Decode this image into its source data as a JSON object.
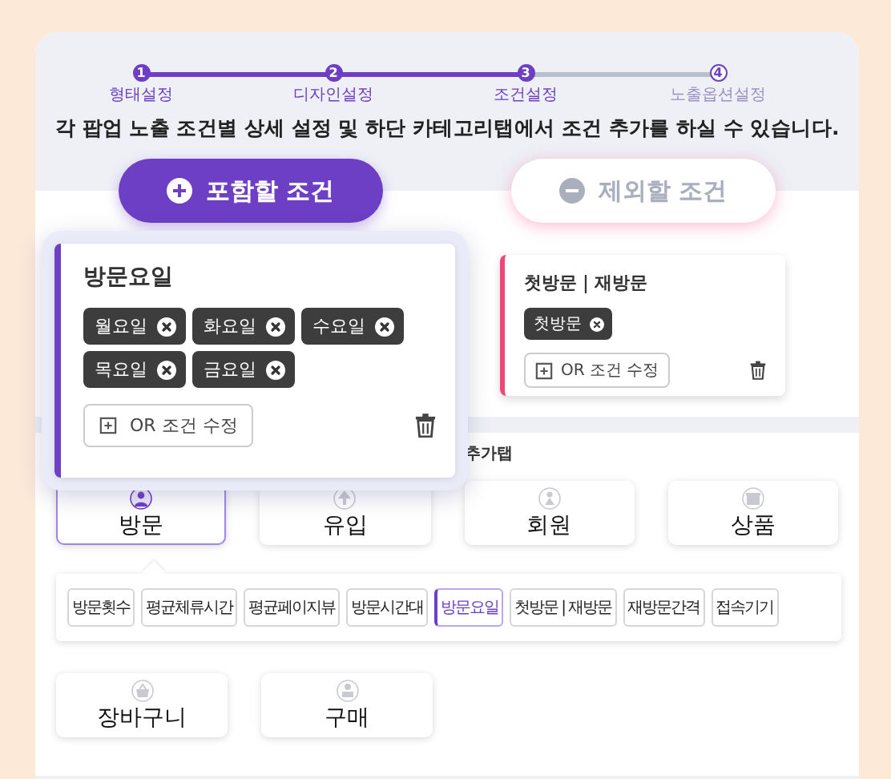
{
  "steps": [
    {
      "number": "1",
      "label": "형태설정",
      "done": true
    },
    {
      "number": "2",
      "label": "디자인설정",
      "done": true
    },
    {
      "number": "3",
      "label": "조건설정",
      "done": true
    },
    {
      "number": "4",
      "label": "노출옵션설정",
      "done": false
    }
  ],
  "instruction": "각 팝업 노출 조건별 상세 설정 및 하단 카테고리탭에서 조건 추가를 하실 수 있습니다.",
  "mode_buttons": [
    {
      "label": "포함할 조건",
      "selected": true
    },
    {
      "label": "제외할 조건",
      "selected": false
    }
  ],
  "condition_cards": [
    {
      "title": "방문요일",
      "color": "#6c3fc5",
      "popped": true,
      "tags": [
        "월요일",
        "화요일",
        "수요일",
        "목요일",
        "금요일"
      ],
      "button": "OR 조건 수정"
    },
    {
      "title": "첫방문｜재방문",
      "color": "#f0467a",
      "popped": false,
      "tags": [
        "첫방문"
      ],
      "button": "OR 조건 수정"
    }
  ],
  "category_label": "추가탭",
  "category_rows": [
    {
      "categories": [
        {
          "label": "방문",
          "selected": true
        },
        {
          "label": "유입",
          "selected": false
        },
        {
          "label": "회원",
          "selected": false
        },
        {
          "label": "상품",
          "selected": false
        }
      ],
      "subtabs": [
        {
          "label": "방문횟수",
          "selected": false
        },
        {
          "label": "평균체류시간",
          "selected": false
        },
        {
          "label": "평균페이지뷰",
          "selected": false
        },
        {
          "label": "방문시간대",
          "selected": false
        },
        {
          "label": "방문요일",
          "selected": true
        },
        {
          "label": "첫방문 | 재방문",
          "selected": false
        },
        {
          "label": "재방문간격",
          "selected": false
        },
        {
          "label": "접속기기",
          "selected": false
        }
      ]
    },
    {
      "categories": [
        {
          "label": "장바구니",
          "selected": false
        },
        {
          "label": "구매",
          "selected": false
        }
      ]
    }
  ]
}
